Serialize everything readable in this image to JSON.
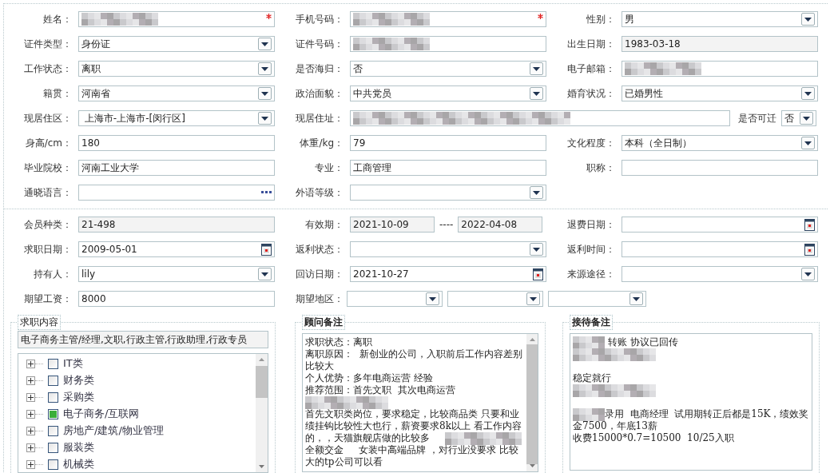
{
  "profile_rows": [
    {
      "cells": [
        {
          "label": "姓名：",
          "kind": "text",
          "redacted": true,
          "required": true
        },
        {
          "label": "手机号码：",
          "kind": "text",
          "redacted": true,
          "required": true
        },
        {
          "label": "性别：",
          "kind": "select",
          "value": "男"
        }
      ]
    },
    {
      "cells": [
        {
          "label": "证件类型：",
          "kind": "select",
          "value": "身份证"
        },
        {
          "label": "证件号码：",
          "kind": "text",
          "redacted": true
        },
        {
          "label": "出生日期：",
          "kind": "text",
          "value": "1983-03-18",
          "readonly": true
        }
      ]
    },
    {
      "cells": [
        {
          "label": "工作状态：",
          "kind": "select",
          "value": "离职"
        },
        {
          "label": "是否海归：",
          "kind": "select",
          "value": "否"
        },
        {
          "label": "电子邮箱：",
          "kind": "text",
          "redacted": true
        }
      ]
    },
    {
      "cells": [
        {
          "label": "籍贯：",
          "kind": "select",
          "value": "河南省"
        },
        {
          "label": "政治面貌：",
          "kind": "select",
          "value": "中共党员"
        },
        {
          "label": "婚育状况：",
          "kind": "select",
          "value": "已婚男性"
        }
      ]
    },
    {
      "cells": [
        {
          "label": "现居住区：",
          "kind": "select",
          "value": " 上海市-上海市-[闵行区]"
        },
        {
          "label": "现居住址：",
          "kind": "address",
          "redacted": true,
          "extra": {
            "label": "是否可迁",
            "kind": "select",
            "value": "否"
          }
        }
      ]
    },
    {
      "cells": [
        {
          "label": "身高/cm：",
          "kind": "text",
          "value": "180"
        },
        {
          "label": "体重/kg：",
          "kind": "text",
          "value": "79"
        },
        {
          "label": "文化程度：",
          "kind": "select",
          "value": "本科（全日制）"
        }
      ]
    },
    {
      "cells": [
        {
          "label": "毕业院校：",
          "kind": "text",
          "value": "河南工业大学"
        },
        {
          "label": "专业：",
          "kind": "text",
          "value": "工商管理"
        },
        {
          "label": "职称：",
          "kind": "text"
        }
      ]
    },
    {
      "cells": [
        {
          "label": "通晓语言：",
          "kind": "lookup"
        },
        {
          "label": "外语等级：",
          "kind": "select"
        }
      ]
    }
  ],
  "member_rows": [
    {
      "cells": [
        {
          "label": "会员种类：",
          "kind": "text",
          "value": "21-498",
          "readonly": true
        },
        {
          "label": "有效期：",
          "kind": "range",
          "values": [
            "2021-10-09",
            "2022-04-08"
          ],
          "separator": "----",
          "readonly": true
        },
        {
          "label": "退费日期：",
          "kind": "date"
        }
      ]
    },
    {
      "cells": [
        {
          "label": "求职日期：",
          "kind": "date",
          "value": "2009-05-01"
        },
        {
          "label": "返利状态：",
          "kind": "select"
        },
        {
          "label": "返利时间：",
          "kind": "date"
        }
      ]
    },
    {
      "cells": [
        {
          "label": "持有人：",
          "kind": "select",
          "value": "lily"
        },
        {
          "label": "回访日期：",
          "kind": "date",
          "value": "2021-10-27"
        },
        {
          "label": "来源途径：",
          "kind": "select"
        }
      ]
    },
    {
      "cells": [
        {
          "label": "期望工资：",
          "kind": "text",
          "value": "8000"
        },
        {
          "label": "期望地区：",
          "kind": "select-group",
          "selects": [
            {
              "kind": "select"
            },
            {
              "kind": "select"
            },
            {
              "kind": "select"
            }
          ]
        }
      ]
    }
  ],
  "job_content": {
    "title": "求职内容",
    "summary": "电子商务主管/经理,文职,行政主管,行政助理,行政专员",
    "tree": [
      {
        "label": "IT类",
        "checked": false
      },
      {
        "label": "财务类",
        "checked": false
      },
      {
        "label": "采购类",
        "checked": false
      },
      {
        "label": "电子商务/互联网",
        "checked": true
      },
      {
        "label": "房地产/建筑/物业管理",
        "checked": false
      },
      {
        "label": "服装类",
        "checked": false
      },
      {
        "label": "机械类",
        "checked": false
      }
    ]
  },
  "advisor_notes": {
    "title": "顾问备注",
    "lines": [
      {
        "kind": "line",
        "parts": [
          {
            "kind": "text",
            "text": "求职状态：离职"
          }
        ]
      },
      {
        "kind": "line",
        "parts": [
          {
            "kind": "text",
            "text": "离职原因：  新创业的公司，入职前后工作内容差别"
          }
        ]
      },
      {
        "kind": "line",
        "parts": [
          {
            "kind": "text",
            "text": "比较大"
          }
        ]
      },
      {
        "kind": "line",
        "parts": [
          {
            "kind": "text",
            "text": "个人优势：多年电商运营 经验"
          }
        ]
      },
      {
        "kind": "line",
        "parts": [
          {
            "kind": "text",
            "text": "推荐范围：首先文职  其次电商运营"
          }
        ]
      },
      {
        "kind": "line",
        "parts": [
          {
            "kind": "redacted"
          }
        ]
      },
      {
        "kind": "line",
        "parts": [
          {
            "kind": "text",
            "text": "首先文职类岗位，要求稳定，比较商品类 只要和业"
          }
        ]
      },
      {
        "kind": "line",
        "parts": [
          {
            "kind": "text",
            "text": "绩挂钩比较性大也行，薪资要求8k以上 看工作内容"
          }
        ]
      },
      {
        "kind": "line",
        "parts": [
          {
            "kind": "text",
            "text": "的，，天猫旗舰店做的比较多     "
          },
          {
            "kind": "redacted"
          }
        ]
      },
      {
        "kind": "line",
        "parts": [
          {
            "kind": "text",
            "text": "全额交金     女装中高端品牌 ，对行业没要求 比较"
          }
        ]
      },
      {
        "kind": "line",
        "parts": [
          {
            "kind": "text",
            "text": "大的tp公司可以看"
          }
        ]
      }
    ]
  },
  "reception_notes": {
    "title": "接待备注",
    "lines": [
      {
        "kind": "line",
        "parts": [
          {
            "kind": "redacted"
          },
          {
            "kind": "text",
            "text": " 转账 协议已回传"
          }
        ]
      },
      {
        "kind": "line",
        "parts": [
          {
            "kind": "redacted"
          }
        ]
      },
      {
        "kind": "blank"
      },
      {
        "kind": "line",
        "parts": [
          {
            "kind": "text",
            "text": "稳定就行"
          }
        ]
      },
      {
        "kind": "line",
        "parts": [
          {
            "kind": "redacted"
          }
        ]
      },
      {
        "kind": "blank"
      },
      {
        "kind": "line",
        "parts": [
          {
            "kind": "redacted"
          },
          {
            "kind": "text",
            "text": "录用  电商经理  试用期转正后都是15K，绩效奖"
          }
        ]
      },
      {
        "kind": "line",
        "parts": [
          {
            "kind": "text",
            "text": "金7500，年底13薪"
          }
        ]
      },
      {
        "kind": "line",
        "parts": [
          {
            "kind": "text",
            "text": "收费15000*0.7=10500  10/25入职"
          }
        ]
      }
    ]
  }
}
